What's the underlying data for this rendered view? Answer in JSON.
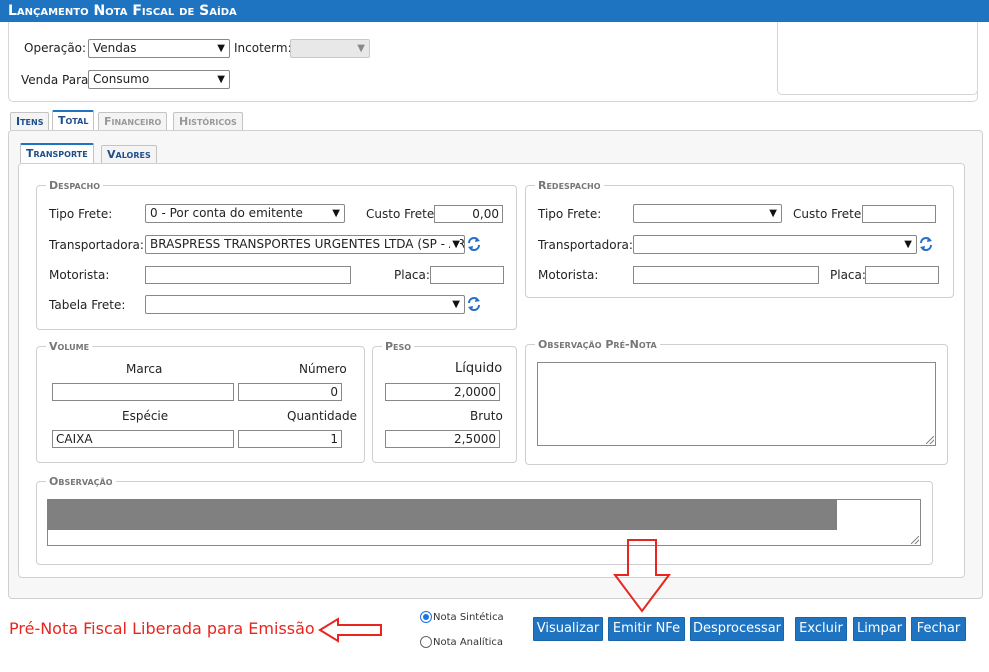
{
  "window": {
    "title": "Lançamento Nota Fiscal de Saída"
  },
  "header": {
    "operacao_label": "Operação:",
    "operacao_value": "Vendas",
    "incoterm_label": "Incoterm:",
    "incoterm_value": "",
    "venda_para_label": "Venda Para:",
    "venda_para_value": "Consumo"
  },
  "tabs": [
    "Itens",
    "Total",
    "Financeiro",
    "Históricos"
  ],
  "subtabs": [
    "Transporte",
    "Valores"
  ],
  "despacho": {
    "legend": "Despacho",
    "tipo_frete_label": "Tipo Frete:",
    "tipo_frete_value": "0 - Por conta do emitente",
    "custo_frete_label": "Custo Frete:",
    "custo_frete_value": "0,00",
    "transportadora_label": "Transportadora:",
    "transportadora_value": "BRASPRESS TRANSPORTES URGENTES LTDA (SP - ARA",
    "motorista_label": "Motorista:",
    "motorista_value": "",
    "placa_label": "Placa:",
    "placa_value": "",
    "tabela_frete_label": "Tabela Frete:",
    "tabela_frete_value": ""
  },
  "redespacho": {
    "legend": "Redespacho",
    "tipo_frete_label": "Tipo Frete:",
    "tipo_frete_value": "",
    "custo_frete_label": "Custo Frete:",
    "custo_frete_value": "",
    "transportadora_label": "Transportadora:",
    "transportadora_value": "",
    "motorista_label": "Motorista:",
    "motorista_value": "",
    "placa_label": "Placa:",
    "placa_value": ""
  },
  "volume": {
    "legend": "Volume",
    "marca_label": "Marca",
    "marca_value": "",
    "numero_label": "Número",
    "numero_value": "0",
    "especie_label": "Espécie",
    "especie_value": "CAIXA",
    "quantidade_label": "Quantidade",
    "quantidade_value": "1"
  },
  "peso": {
    "legend": "Peso",
    "liquido_label": "Líquido",
    "liquido_value": "2,0000",
    "bruto_label": "Bruto",
    "bruto_value": "2,5000"
  },
  "observacao_pre_nota": {
    "legend": "Observação Pré-Nota",
    "value": ""
  },
  "observacao": {
    "legend": "Observação",
    "value": ""
  },
  "footer": {
    "status_text": "Pré-Nota Fiscal Liberada para Emissão",
    "radio_sintetica": "Nota Sintética",
    "radio_analitica": "Nota Analítica",
    "selected_radio": "Nota Sintética",
    "buttons": {
      "visualizar": "Visualizar",
      "emitir": "Emitir NFe",
      "desprocessar": "Desprocessar",
      "excluir": "Excluir",
      "limpar": "Limpar",
      "fechar": "Fechar"
    }
  },
  "colors": {
    "accent": "#1f74c2",
    "annotation_red": "#e8251e",
    "redacted_gray": "#808080"
  }
}
